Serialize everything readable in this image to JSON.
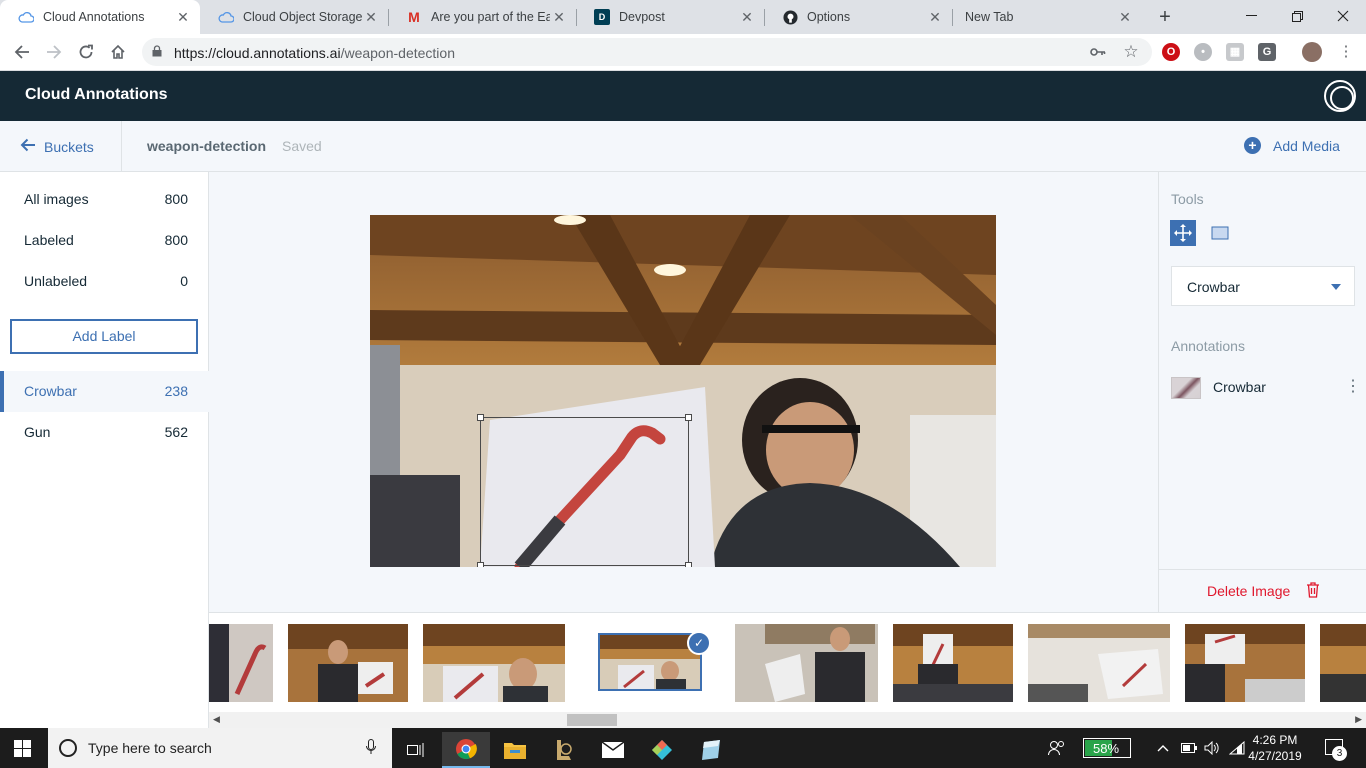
{
  "browser": {
    "tabs": [
      {
        "title": "Cloud Annotations",
        "active": true,
        "icon": "cloud-icon"
      },
      {
        "title": "Cloud Object Storage -",
        "active": false,
        "icon": "cloud-icon"
      },
      {
        "title": "Are you part of the Eag",
        "active": false,
        "icon": "gmail-icon"
      },
      {
        "title": "Devpost",
        "active": false,
        "icon": "devpost-icon"
      },
      {
        "title": "Options",
        "active": false,
        "icon": "github-icon"
      },
      {
        "title": "New Tab",
        "active": false,
        "icon": "none"
      }
    ],
    "url_host": "https://cloud.annotations.ai",
    "url_path": "/weapon-detection"
  },
  "app": {
    "brand": "Cloud Annotations"
  },
  "subheader": {
    "back_label": "Buckets",
    "bucket_name": "weapon-detection",
    "status": "Saved",
    "add_media_label": "Add Media"
  },
  "sidebar": {
    "filters": [
      {
        "label": "All images",
        "count": "800"
      },
      {
        "label": "Labeled",
        "count": "800"
      },
      {
        "label": "Unlabeled",
        "count": "0"
      }
    ],
    "add_label_button": "Add Label",
    "labels": [
      {
        "label": "Crowbar",
        "count": "238",
        "selected": true
      },
      {
        "label": "Gun",
        "count": "562",
        "selected": false
      }
    ]
  },
  "tools_panel": {
    "tools_heading": "Tools",
    "selected_label": "Crowbar",
    "annotations_heading": "Annotations",
    "annotations": [
      {
        "label": "Crowbar"
      }
    ],
    "delete_label": "Delete Image"
  },
  "taskbar": {
    "search_placeholder": "Type here to search",
    "battery": "58%",
    "battery_level": 0.58,
    "time": "4:26 PM",
    "date": "4/27/2019",
    "notifications": "3"
  },
  "colors": {
    "accent": "#3d70b2",
    "header": "#152935",
    "danger": "#e0182d"
  }
}
